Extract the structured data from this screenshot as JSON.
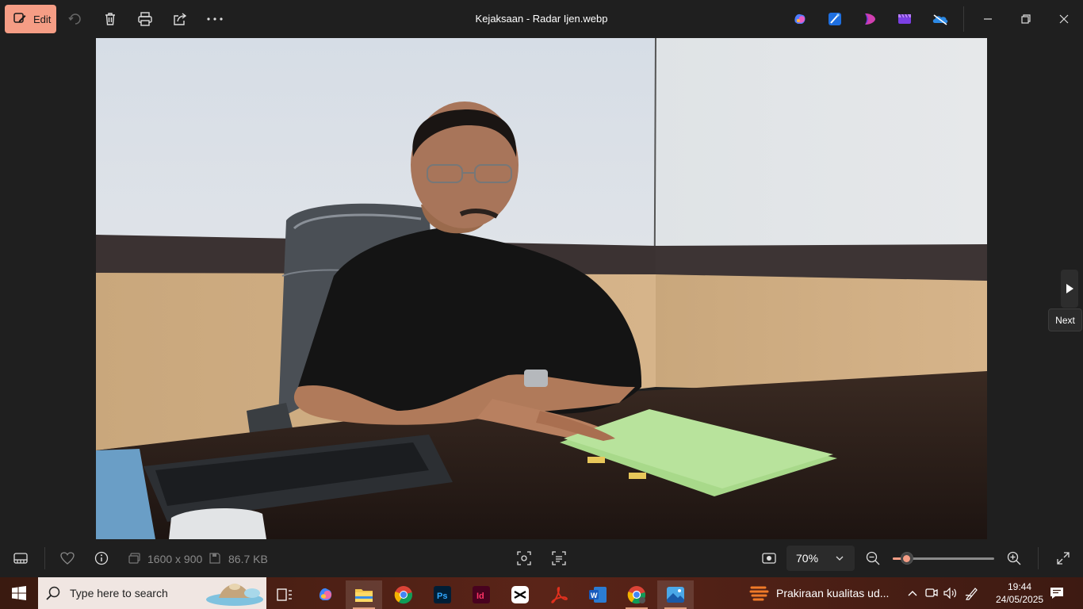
{
  "window": {
    "title": "Kejaksaan - Radar Ijen.webp",
    "edit_label": "Edit",
    "next_tooltip": "Next"
  },
  "toolbar": {
    "icons": [
      "rotate-icon",
      "trash-icon",
      "print-icon",
      "share-icon",
      "more-icon"
    ]
  },
  "info": {
    "dimensions": "1600 x 900",
    "file_size": "86.7 KB"
  },
  "zoom": {
    "value": "70%",
    "level": 0.14
  },
  "taskbar": {
    "search_placeholder": "Type here to search",
    "news_text": "Prakiraan kualitas ud...",
    "time": "19:44",
    "date": "24/05/2025"
  },
  "colors": {
    "accent": "#f59d85",
    "background": "#1f1f1f"
  }
}
